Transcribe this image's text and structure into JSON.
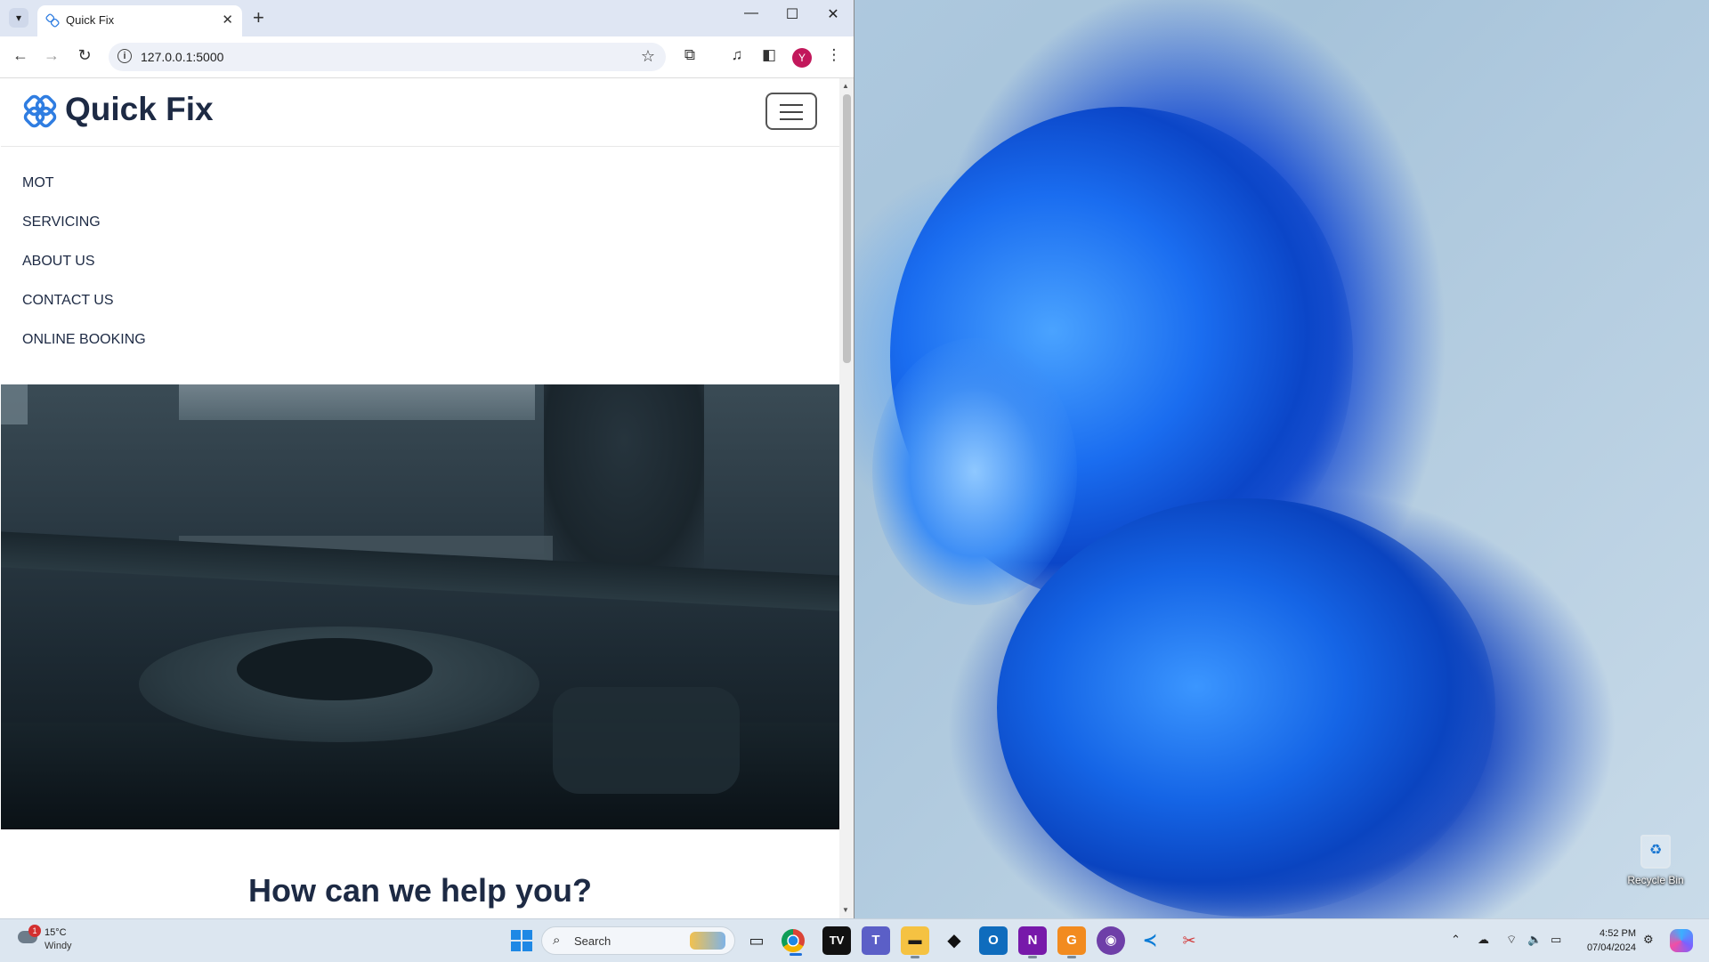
{
  "browser": {
    "tab_title": "Quick Fix",
    "url": "127.0.0.1:5000",
    "profile_initial": "Y",
    "window_controls": {
      "minimize": "—",
      "maximize": "☐",
      "close": "✕"
    }
  },
  "site": {
    "brand": "Quick Fix",
    "menu": [
      "MOT",
      "SERVICING",
      "ABOUT US",
      "CONTACT US",
      "ONLINE BOOKING"
    ],
    "help_heading": "How can we help you?",
    "accent_color": "#1d2a44",
    "logo_color": "#2f7de1"
  },
  "desktop": {
    "recycle_bin_label": "Recycle Bin"
  },
  "taskbar": {
    "weather": {
      "temp": "15°C",
      "condition": "Windy",
      "badge": "1"
    },
    "search_label": "Search",
    "apps": [
      "chrome-icon",
      "tradingview-icon",
      "teams-icon",
      "file-explorer-icon",
      "alienware-icon",
      "outlook-icon",
      "onenote-icon",
      "pdf-editor-icon",
      "github-icon",
      "vscode-icon",
      "snipping-tool-icon"
    ],
    "clock": {
      "time": "4:52 PM",
      "date": "07/04/2024"
    }
  }
}
